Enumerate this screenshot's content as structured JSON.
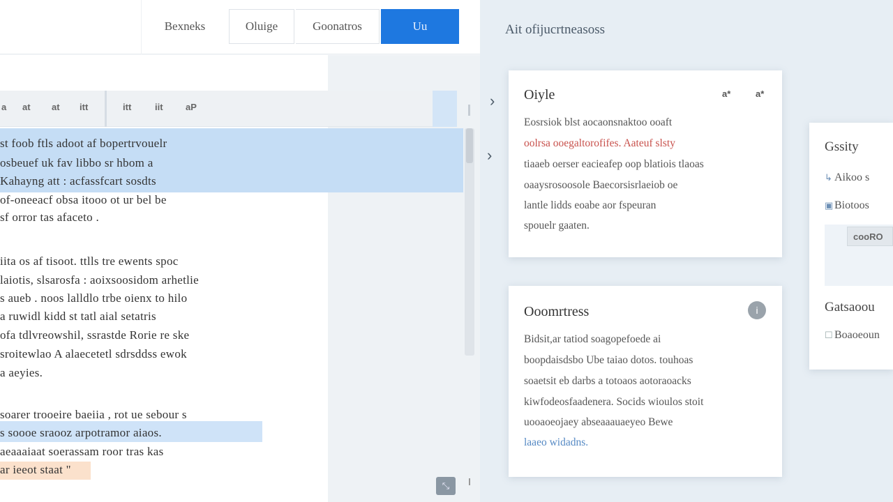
{
  "toolbar": {
    "btn1": "Bexneks",
    "btn2": "Oluige",
    "btn3": "Goonatros",
    "btn_primary": "Uu"
  },
  "format_icons": [
    "a",
    "at",
    "at",
    "itt",
    "itt",
    "iit",
    "aP"
  ],
  "editor_lines": [
    "st  foob  ftls  adoot  af  bopertrvouelr",
    "osbeuef  uk  fav  libbo  sr  hbom  a",
    "  Kahayng  att  :  acfassfcart  sosdts",
    "of-oneeacf  obsa  itooo  ot  ur  bel  be",
    "sf  orror  tas  afaceto  .",
    "iita  os  af  tisoot.  ttlls  tre  ewents  spoc",
    "laiotis,  slsarosfa  :  aoixsoosidom  arhetlie",
    "s  aueb  .  noos  lalldlo  trbe  oienx  to  hilo",
    "a  ruwidl  kidd  st  tatl  aial  setatris",
    "ofa  tdlvreowshil,  ssrastde  Rorie  re  ske",
    "sroitewlao  A  alaecetetl  sdrsddss  ewok",
    "a  aeyies.",
    "soarer  trooeire  baeiia  ,  rot  ue  sebour  s",
    "s  soooe  sraooz  arpotramor  aiaos.",
    "aeaaaiaat  soerassam  roor  tras  kas",
    "ar  ieeot  staat  \""
  ],
  "right_title": "Ait  ofijucrtneasoss",
  "style_card": {
    "title": "Oiyle",
    "icon_a": "a*",
    "icon_b": "a*",
    "lines": [
      "Eosrsiok  blst  aocaonsnaktoo  ooaft",
      "oolrsa  ooegaltorofifes.  Aateuf  slsty",
      "tiaaeb  oerser  eacieafep  oop  blatiois  tlaoas",
      "oaaysrosoosole  Baecorsisrlaeiob  oe",
      "lantle  lidds  eoabe  aor  fspeuran",
      "spouelr  gaaten."
    ]
  },
  "comm_card": {
    "title": "Ooomrtress",
    "info": "i",
    "lines": [
      "Bidsit,ar  tatiod  soagopefoede  ai",
      "boopdaisdsbo  Ube  taiao  dotos.  touhoas",
      "soaetsit  eb  darbs  a  totoaos  aotoraoacks",
      "kiwfodeosfaadenera.  Socids  wioulos  stoit",
      "uooaoeojaey  abseaaauaeyeo  Bewe",
      "laaeo  widadns."
    ]
  },
  "side_card": {
    "title": "Gssity",
    "row1": "Aikoo  s",
    "row2": "Biotoos",
    "chip": "cooRO",
    "title2": "Gatsaoou",
    "row3": "Boaoeoun"
  },
  "corner_icon": "⤡"
}
